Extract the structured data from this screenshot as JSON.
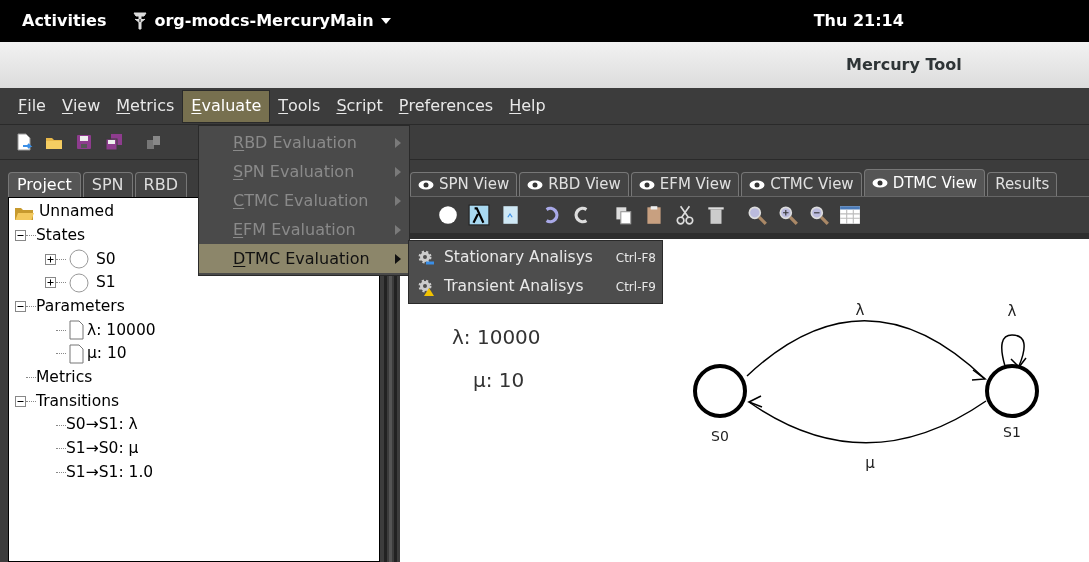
{
  "top_bar": {
    "activities": "Activities",
    "app_menu": "org-modcs-MercuryMain",
    "clock": "Thu 21:14"
  },
  "window": {
    "title": "Mercury Tool"
  },
  "menu_bar": [
    {
      "label": "File",
      "selected": false
    },
    {
      "label": "View",
      "selected": false
    },
    {
      "label": "Metrics",
      "selected": false
    },
    {
      "label": "Evaluate",
      "selected": true
    },
    {
      "label": "Tools",
      "selected": false
    },
    {
      "label": "Script",
      "selected": false
    },
    {
      "label": "Preferences",
      "selected": false
    },
    {
      "label": "Help",
      "selected": false
    }
  ],
  "evaluate_menu": [
    {
      "label": "RBD Evaluation",
      "disabled": true,
      "selected": false
    },
    {
      "label": "SPN Evaluation",
      "disabled": true,
      "selected": false
    },
    {
      "label": "CTMC Evaluation",
      "disabled": true,
      "selected": false
    },
    {
      "label": "EFM Evaluation",
      "disabled": true,
      "selected": false
    },
    {
      "label": "DTMC Evaluation",
      "disabled": false,
      "selected": true
    }
  ],
  "submenu": [
    {
      "label": "Stationary Analisys",
      "shortcut": "Ctrl-F8",
      "kind": "stationary"
    },
    {
      "label": "Transient Analisys",
      "shortcut": "Ctrl-F9",
      "kind": "transient"
    }
  ],
  "left_tabs": [
    {
      "label": "Project",
      "selected": true
    },
    {
      "label": "SPN",
      "selected": false
    },
    {
      "label": "RBD",
      "selected": false
    }
  ],
  "tree": {
    "label": "Unnamed",
    "kind": "root",
    "children": [
      {
        "label": "States",
        "expanded": true,
        "children": [
          {
            "label": "S0",
            "kind": "state",
            "expanded": false
          },
          {
            "label": "S1",
            "kind": "state",
            "expanded": false
          }
        ]
      },
      {
        "label": "Parameters",
        "expanded": true,
        "children": [
          {
            "label": "λ: 10000",
            "kind": "parameter"
          },
          {
            "label": "μ: 10",
            "kind": "parameter"
          }
        ]
      },
      {
        "label": "Metrics"
      },
      {
        "label": "Transitions",
        "expanded": true,
        "children": [
          {
            "label": "S0→S1: λ"
          },
          {
            "label": "S1→S0: μ"
          },
          {
            "label": "S1→S1: 1.0"
          }
        ]
      }
    ]
  },
  "view_tabs": [
    {
      "label": "SPN View",
      "selected": false
    },
    {
      "label": "RBD View",
      "selected": false
    },
    {
      "label": "EFM View",
      "selected": false
    },
    {
      "label": "CTMC View",
      "selected": false
    },
    {
      "label": "DTMC View",
      "selected": true
    },
    {
      "label": "Results",
      "selected": false
    }
  ],
  "canvas": {
    "parameters": [
      "λ: 10000",
      "μ: 10"
    ],
    "states": [
      {
        "label": "S0"
      },
      {
        "label": "S1"
      }
    ],
    "transitions": [
      {
        "label": "λ",
        "kind": "forward"
      },
      {
        "label": "μ",
        "kind": "back"
      },
      {
        "label": "λ",
        "kind": "self"
      }
    ]
  }
}
